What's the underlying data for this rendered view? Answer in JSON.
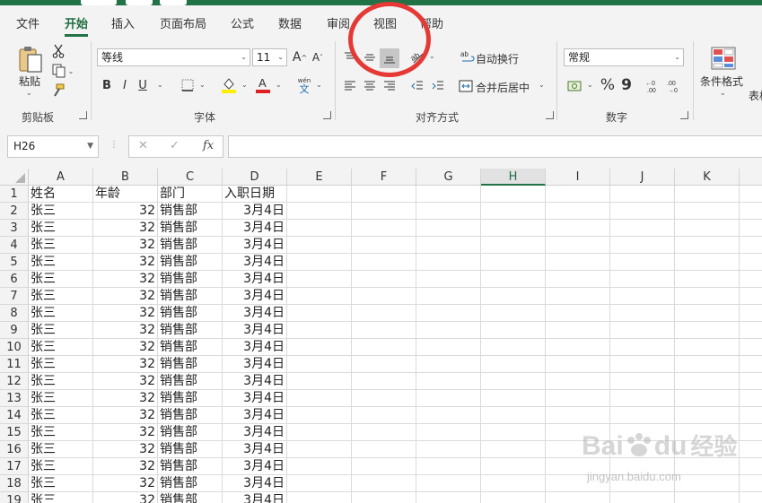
{
  "tabs": [
    {
      "label": "文件",
      "active": false
    },
    {
      "label": "开始",
      "active": true
    },
    {
      "label": "插入",
      "active": false
    },
    {
      "label": "页面布局",
      "active": false
    },
    {
      "label": "公式",
      "active": false
    },
    {
      "label": "数据",
      "active": false
    },
    {
      "label": "审阅",
      "active": false
    },
    {
      "label": "视图",
      "active": false
    },
    {
      "label": "帮助",
      "active": false
    }
  ],
  "ribbon": {
    "clipboard": {
      "paste_label": "粘贴",
      "group_label": "剪贴板"
    },
    "font": {
      "name": "等线",
      "size": "11",
      "group_label": "字体",
      "bold": "B",
      "italic": "I",
      "underline": "U",
      "pinyin_top": "wén",
      "pinyin_bottom": "文"
    },
    "alignment": {
      "wrap_text": "自动换行",
      "merge_center": "合并后居中",
      "group_label": "对齐方式"
    },
    "number": {
      "format": "常规",
      "group_label": "数字",
      "percent": "%",
      "comma": "9"
    },
    "styles": {
      "conditional_format": "条件格式",
      "table_partial": "表格"
    }
  },
  "formula_bar": {
    "name_box": "H26",
    "cancel": "✕",
    "enter": "✓",
    "fx": "fx",
    "formula": ""
  },
  "grid": {
    "selected_column": "H",
    "columns": [
      "A",
      "B",
      "C",
      "D",
      "E",
      "F",
      "G",
      "H",
      "I",
      "J",
      "K"
    ],
    "rows": [
      {
        "n": "1",
        "cells": [
          "姓名",
          "年龄",
          "部门",
          "入职日期"
        ]
      },
      {
        "n": "2",
        "cells": [
          "张三",
          "32",
          "销售部",
          "3月4日"
        ]
      },
      {
        "n": "3",
        "cells": [
          "张三",
          "32",
          "销售部",
          "3月4日"
        ]
      },
      {
        "n": "4",
        "cells": [
          "张三",
          "32",
          "销售部",
          "3月4日"
        ]
      },
      {
        "n": "5",
        "cells": [
          "张三",
          "32",
          "销售部",
          "3月4日"
        ]
      },
      {
        "n": "6",
        "cells": [
          "张三",
          "32",
          "销售部",
          "3月4日"
        ]
      },
      {
        "n": "7",
        "cells": [
          "张三",
          "32",
          "销售部",
          "3月4日"
        ]
      },
      {
        "n": "8",
        "cells": [
          "张三",
          "32",
          "销售部",
          "3月4日"
        ]
      },
      {
        "n": "9",
        "cells": [
          "张三",
          "32",
          "销售部",
          "3月4日"
        ]
      },
      {
        "n": "10",
        "cells": [
          "张三",
          "32",
          "销售部",
          "3月4日"
        ]
      },
      {
        "n": "11",
        "cells": [
          "张三",
          "32",
          "销售部",
          "3月4日"
        ]
      },
      {
        "n": "12",
        "cells": [
          "张三",
          "32",
          "销售部",
          "3月4日"
        ]
      },
      {
        "n": "13",
        "cells": [
          "张三",
          "32",
          "销售部",
          "3月4日"
        ]
      },
      {
        "n": "14",
        "cells": [
          "张三",
          "32",
          "销售部",
          "3月4日"
        ]
      },
      {
        "n": "15",
        "cells": [
          "张三",
          "32",
          "销售部",
          "3月4日"
        ]
      },
      {
        "n": "16",
        "cells": [
          "张三",
          "32",
          "销售部",
          "3月4日"
        ]
      },
      {
        "n": "17",
        "cells": [
          "张三",
          "32",
          "销售部",
          "3月4日"
        ]
      },
      {
        "n": "18",
        "cells": [
          "张三",
          "32",
          "销售部",
          "3月4日"
        ]
      },
      {
        "n": "19",
        "cells": [
          "张三",
          "32",
          "销售部",
          "3月4日"
        ]
      }
    ]
  },
  "watermark": {
    "brand": "Bai",
    "brand2": "du",
    "suffix": "经验",
    "url": "jingyan.baidu.com"
  },
  "colors": {
    "accent": "#217346",
    "annotation": "#e53935",
    "font_color_bar": "#e02020",
    "fill_color_bar": "#ffee00"
  }
}
